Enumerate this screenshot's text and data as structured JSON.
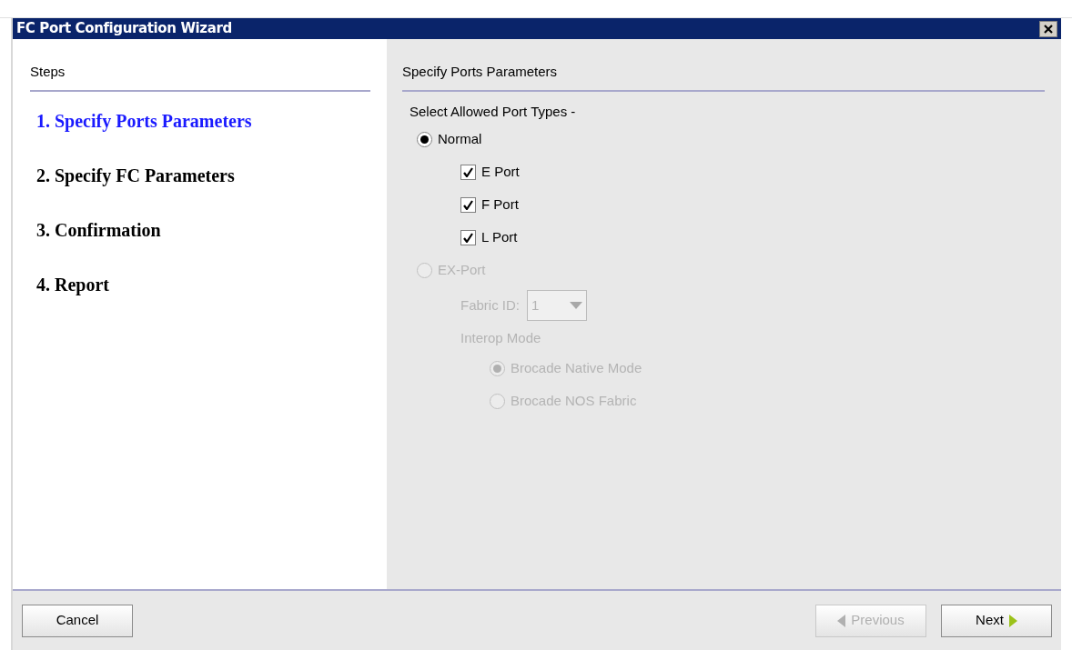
{
  "window": {
    "title": "FC Port Configuration Wizard"
  },
  "steps": {
    "heading": "Steps",
    "items": [
      {
        "label": "1. Specify Ports Parameters",
        "selected": true
      },
      {
        "label": "2. Specify FC Parameters",
        "selected": false
      },
      {
        "label": "3. Confirmation",
        "selected": false
      },
      {
        "label": "4. Report",
        "selected": false
      }
    ]
  },
  "panel": {
    "title": "Specify Ports Parameters",
    "group_label": "Select Allowed Port Types -",
    "options": [
      {
        "kind": "radio",
        "label": "Normal",
        "selected": true,
        "disabled": false,
        "children": [
          {
            "kind": "checkbox",
            "label": "E Port",
            "checked": true,
            "disabled": false
          },
          {
            "kind": "checkbox",
            "label": "F Port",
            "checked": true,
            "disabled": false
          },
          {
            "kind": "checkbox",
            "label": "L Port",
            "checked": true,
            "disabled": false
          }
        ]
      },
      {
        "kind": "radio",
        "label": "EX-Port",
        "selected": false,
        "disabled": true,
        "children": [
          {
            "kind": "dropdown",
            "label": "Fabric ID:",
            "value": "1",
            "disabled": true
          },
          {
            "kind": "group",
            "label": "Interop Mode",
            "disabled": true,
            "children": [
              {
                "kind": "radio",
                "label": "Brocade Native Mode",
                "selected": true,
                "disabled": true
              },
              {
                "kind": "radio",
                "label": "Brocade NOS Fabric",
                "selected": false,
                "disabled": true
              }
            ]
          }
        ]
      }
    ]
  },
  "buttons": [
    {
      "kind": "cancel",
      "label": "Cancel",
      "disabled": false
    },
    {
      "kind": "previous",
      "label": "Previous",
      "disabled": true
    },
    {
      "kind": "next",
      "label": "Next",
      "disabled": false
    }
  ]
}
